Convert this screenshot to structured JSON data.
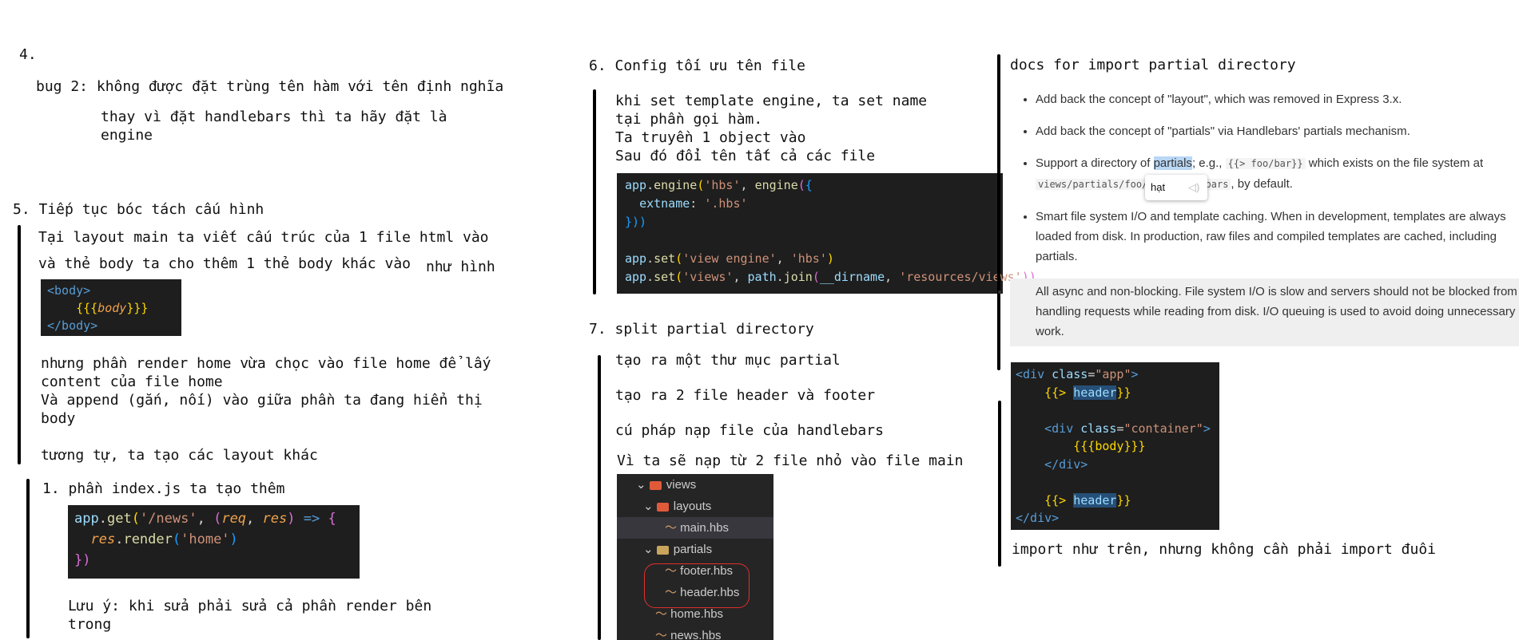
{
  "col1": {
    "s4_heading": "4.",
    "s4_line1": "bug 2: không được đặt trùng tên hàm với tên định nghĩa",
    "s4_line2": "thay vì đặt handlebars thì ta hãy đặt là",
    "s4_line3": "engine",
    "s5_heading": "5. Tiếp tục bóc tách cấu hình",
    "s5_line1": "Tại layout main ta viết cấu trúc của 1 file html vào",
    "s5_line2a": "và thẻ body ta cho thêm 1 thẻ body khác vào",
    "s5_line2b": "như hình",
    "body_code": {
      "open": "<body>",
      "inner_open": "{{{",
      "inner_var": "body",
      "inner_close": "}}}",
      "close": "</body>"
    },
    "s5_line3": "nhưng phần render home vừa chọc vào file home để lấy",
    "s5_line4": "content của file home",
    "s5_line5": "Và append (gắn, nối) vào giữa phần ta đang hiển thị",
    "s5_line6": "body",
    "s5_line7": "tương tự, ta tạo các layout khác",
    "s5_sub1": "1. phần index.js ta tạo thêm",
    "news_code": {
      "l1_app": "app",
      "l1_dot": ".",
      "l1_get": "get",
      "l1_p": "(",
      "l1_str": "'/news'",
      "l1_comma": ", ",
      "l1_p2": "(",
      "l1_req": "req",
      "l1_c2": ", ",
      "l1_res": "res",
      "l1_p3": ")",
      "l1_arrow": " => ",
      "l1_brace": "{",
      "l2_res": "res",
      "l2_dot": ".",
      "l2_render": "render",
      "l2_p": "(",
      "l2_str": "'home'",
      "l2_p2": ")",
      "l3": "})"
    },
    "note1": "Lưu ý: khi sửa phải sửa cả phần render bên",
    "note2": "trong"
  },
  "col2": {
    "s6_heading": "6. Config tối ưu tên file",
    "s6_line1": "khi set template engine, ta set name",
    "s6_line2": "tại phần gọi hàm.",
    "s6_line3": "Ta truyền 1 object vào",
    "s6_line4": "Sau đó đổi tên tất cả các file",
    "engine_code": {
      "l1_app": "app",
      "l1_dot": ".",
      "l1_engine": "engine",
      "l1_p": "(",
      "l1_str": "'hbs'",
      "l1_comma": ", ",
      "l1_fn": "engine",
      "l1_p2": "(",
      "l1_br": "{",
      "l2_key": "extname",
      "l2_colon": ": ",
      "l2_val": "'.hbs'",
      "l3": "}))",
      "l5_app": "app",
      "l5_dot": ".",
      "l5_set": "set",
      "l5_p": "(",
      "l5_a": "'view engine'",
      "l5_c": ", ",
      "l5_b": "'hbs'",
      "l5_p2": ")",
      "l6_app": "app",
      "l6_dot": ".",
      "l6_set": "set",
      "l6_p": "(",
      "l6_a": "'views'",
      "l6_c": ", ",
      "l6_path": "path",
      "l6_dot2": ".",
      "l6_join": "join",
      "l6_p2": "(",
      "l6_dir": "__dirname",
      "l6_c2": ", ",
      "l6_b": "'resources/views'",
      "l6_p3": "))"
    },
    "s7_heading": "7. split partial directory",
    "s7_line1": "tạo ra một thư mục partial",
    "s7_line2": "tạo ra 2 file header và footer",
    "s7_line3": "cú pháp nạp file của handlebars",
    "s7_line4": "Vì ta sẽ nạp từ 2 file nhỏ vào file main",
    "tree": {
      "views": "views",
      "layouts": "layouts",
      "main": "main.hbs",
      "partials": "partials",
      "footer": "footer.hbs",
      "header": "header.hbs",
      "home": "home.hbs",
      "news": "news.hbs"
    }
  },
  "col3": {
    "docs_heading": "docs for import partial directory",
    "bullet1": "Add back the concept of \"layout\", which was removed in Express 3.x.",
    "bullet2": "Add back the concept of \"partials\" via Handlebars' partials mechanism.",
    "bullet3_a": "Support a directory of ",
    "bullet3_hl": "partials",
    "bullet3_b": "; e.g., ",
    "bullet3_code1": "{{> foo/bar}}",
    "bullet3_c": " which exists on the file system at",
    "bullet3_code2": "views/partials/foo/bar.handlebars",
    "bullet3_d": ", by default.",
    "tooltip": "hạt",
    "bullet4": "Smart file system I/O and template caching. When in development, templates are always loaded from disk. In production, raw files and compiled templates are cached, including partials.",
    "bullet5": "All async and non-blocking. File system I/O is slow and servers should not be blocked from handling requests while reading from disk. I/O queuing is used to avoid doing unnecessary work.",
    "partial_code": {
      "l1_open": "<div",
      "l1_attr": " class",
      "l1_eq": "=",
      "l1_val": "\"app\"",
      "l1_close": ">",
      "l2_a": "{{> ",
      "l2_b": "header",
      "l2_c": "}}",
      "l4_open": "<div",
      "l4_attr": " class",
      "l4_eq": "=",
      "l4_val": "\"container\"",
      "l4_close": ">",
      "l5": "{{{body}}}",
      "l6": "</div>",
      "l8_a": "{{> ",
      "l8_b": "header",
      "l8_c": "}}",
      "l9": "</div>"
    },
    "import_note": "import như trên, nhưng không cần phải import đuôi"
  }
}
